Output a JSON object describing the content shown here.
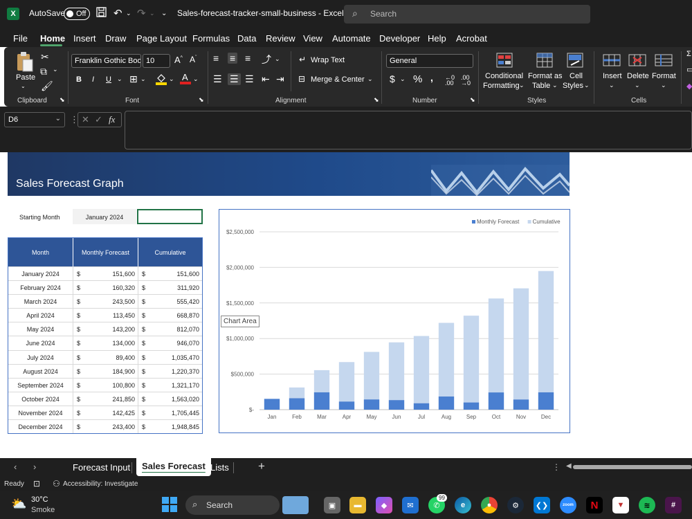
{
  "titlebar": {
    "autosave_label": "AutoSave",
    "autosave_state": "Off",
    "doc_title": "Sales-forecast-tracker-small-business  -  Excel",
    "search_placeholder": "Search"
  },
  "menu": [
    "File",
    "Home",
    "Insert",
    "Draw",
    "Page Layout",
    "Formulas",
    "Data",
    "Review",
    "View",
    "Automate",
    "Developer",
    "Help",
    "Acrobat"
  ],
  "active_menu": "Home",
  "ribbon": {
    "clipboard": {
      "paste": "Paste",
      "label": "Clipboard"
    },
    "font": {
      "family": "Franklin Gothic Boo",
      "size": "10",
      "label": "Font",
      "bold": "B",
      "italic": "I",
      "underline": "U"
    },
    "alignment": {
      "wrap": "Wrap Text",
      "merge": "Merge & Center",
      "label": "Alignment"
    },
    "number": {
      "format": "General",
      "label": "Number"
    },
    "styles": {
      "conditional_1": "Conditional",
      "conditional_2": "Formatting",
      "format_as_1": "Format as",
      "format_as_2": "Table",
      "cell_1": "Cell",
      "cell_2": "Styles",
      "label": "Styles"
    },
    "cells": {
      "insert": "Insert",
      "delete": "Delete",
      "format": "Format",
      "label": "Cells"
    }
  },
  "formula_bar": {
    "name_box": "D6",
    "fx": "fx",
    "value": ""
  },
  "sheet": {
    "banner_title": "Sales Forecast Graph",
    "starting_month_label": "Starting Month",
    "starting_month_value": "January 2024",
    "table_headers": [
      "Month",
      "Monthly Forecast",
      "Cumulative"
    ],
    "currency_symbol": "$",
    "rows": [
      {
        "month": "January 2024",
        "forecast": "151,600",
        "cumulative": "151,600"
      },
      {
        "month": "February 2024",
        "forecast": "160,320",
        "cumulative": "311,920"
      },
      {
        "month": "March 2024",
        "forecast": "243,500",
        "cumulative": "555,420"
      },
      {
        "month": "April 2024",
        "forecast": "113,450",
        "cumulative": "668,870"
      },
      {
        "month": "May 2024",
        "forecast": "143,200",
        "cumulative": "812,070"
      },
      {
        "month": "June 2024",
        "forecast": "134,000",
        "cumulative": "946,070"
      },
      {
        "month": "July 2024",
        "forecast": "89,400",
        "cumulative": "1,035,470"
      },
      {
        "month": "August 2024",
        "forecast": "184,900",
        "cumulative": "1,220,370"
      },
      {
        "month": "September 2024",
        "forecast": "100,800",
        "cumulative": "1,321,170"
      },
      {
        "month": "October 2024",
        "forecast": "241,850",
        "cumulative": "1,563,020"
      },
      {
        "month": "November 2024",
        "forecast": "142,425",
        "cumulative": "1,705,445"
      },
      {
        "month": "December 2024",
        "forecast": "243,400",
        "cumulative": "1,948,845"
      }
    ],
    "chart_tooltip": "Chart Area"
  },
  "chart_data": {
    "type": "bar",
    "categories": [
      "Jan",
      "Feb",
      "Mar",
      "Apr",
      "May",
      "Jun",
      "Jul",
      "Aug",
      "Sep",
      "Oct",
      "Nov",
      "Dec"
    ],
    "series": [
      {
        "name": "Monthly Forecast",
        "color": "#4a7fd0",
        "values": [
          151600,
          160320,
          243500,
          113450,
          143200,
          134000,
          89400,
          184900,
          100800,
          241850,
          142425,
          243400
        ]
      },
      {
        "name": "Cumulative",
        "color": "#c5d7ee",
        "values": [
          151600,
          311920,
          555420,
          668870,
          812070,
          946070,
          1035470,
          1220370,
          1321170,
          1563020,
          1705445,
          1948845
        ]
      }
    ],
    "y_ticks": [
      "$-",
      "$500,000",
      "$1,000,000",
      "$1,500,000",
      "$2,000,000",
      "$2,500,000"
    ],
    "ylim": [
      0,
      2500000
    ],
    "grid": true,
    "legend": "top-right",
    "overlap": true
  },
  "tabs": [
    "Forecast Input",
    "Sales Forecast",
    "Lists"
  ],
  "active_tab": "Sales Forecast",
  "status": {
    "ready": "Ready",
    "accessibility": "Accessibility: Investigate"
  },
  "taskbar": {
    "weather_temp": "30°C",
    "weather_desc": "Smoke",
    "search": "Search",
    "badge": "99"
  }
}
